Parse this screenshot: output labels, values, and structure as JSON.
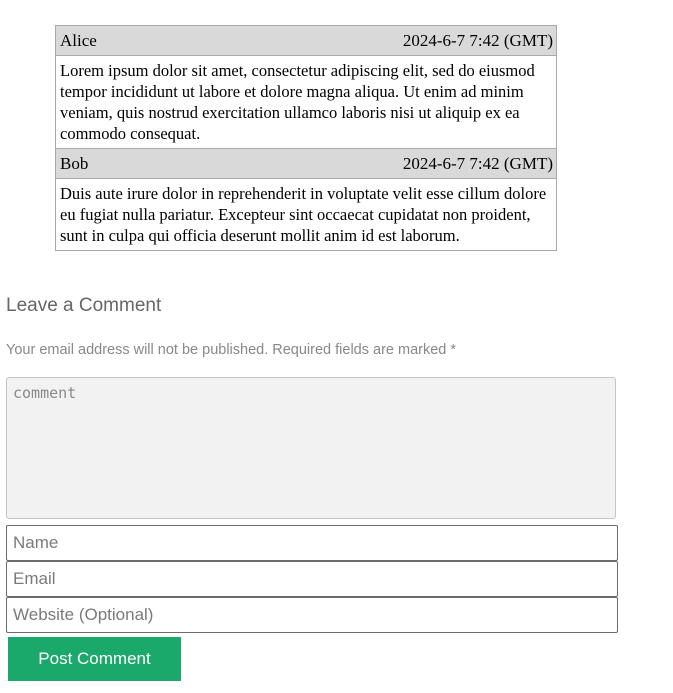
{
  "comments": [
    {
      "author": "Alice",
      "date": "2024-6-7 7:42 (GMT)",
      "text": "Lorem ipsum dolor sit amet, consectetur adipiscing elit, sed do eiusmod tempor incididunt ut labore et dolore magna aliqua. Ut enim ad minim veniam, quis nostrud exercitation ullamco laboris nisi ut aliquip ex ea commodo consequat."
    },
    {
      "author": "Bob",
      "date": "2024-6-7 7:42 (GMT)",
      "text": "Duis aute irure dolor in reprehenderit in voluptate velit esse cillum dolore eu fugiat nulla pariatur. Excepteur sint occaecat cupidatat non proident, sunt in culpa qui officia deserunt mollit anim id est laborum."
    }
  ],
  "reply": {
    "title": "Leave a Comment",
    "notes": "Your email address will not be published. Required fields are marked *",
    "comment_placeholder": "comment",
    "name_placeholder": "Name",
    "email_placeholder": "Email",
    "website_placeholder": "Website (Optional)",
    "submit_label": "Post Comment"
  },
  "colors": {
    "header_bg": "#d9d9d9",
    "border": "#a9a9a9",
    "button_bg": "#1ba86b",
    "button_text": "#ffffff",
    "muted_text": "#888888"
  }
}
